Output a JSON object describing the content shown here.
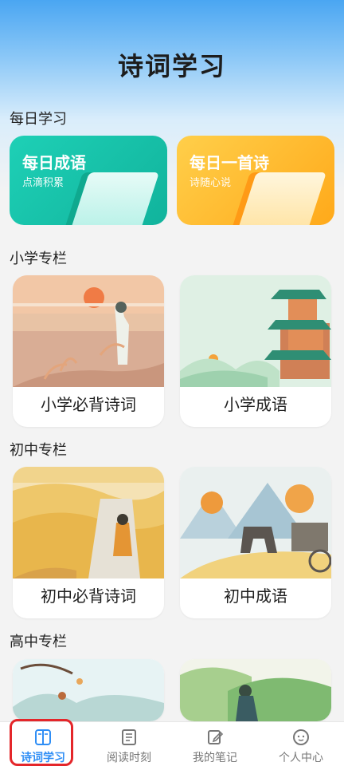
{
  "header": {
    "title": "诗词学习"
  },
  "sections": {
    "daily": "每日学习",
    "primary": "小学专栏",
    "junior": "初中专栏",
    "senior": "高中专栏"
  },
  "daily_cards": [
    {
      "title": "每日成语",
      "subtitle": "点滴积累"
    },
    {
      "title": "每日一首诗",
      "subtitle": "诗随心说"
    }
  ],
  "cards": {
    "primary_poems": "小学必背诗词",
    "primary_idioms": "小学成语",
    "junior_poems": "初中必背诗词",
    "junior_idioms": "初中成语"
  },
  "tabs": [
    {
      "label": "诗词学习",
      "icon": "book-icon",
      "active": true
    },
    {
      "label": "阅读时刻",
      "icon": "document-icon",
      "active": false
    },
    {
      "label": "我的笔记",
      "icon": "note-edit-icon",
      "active": false
    },
    {
      "label": "个人中心",
      "icon": "user-face-icon",
      "active": false
    }
  ],
  "colors": {
    "accent": "#2f8ef5",
    "highlight": "#e4262a"
  }
}
